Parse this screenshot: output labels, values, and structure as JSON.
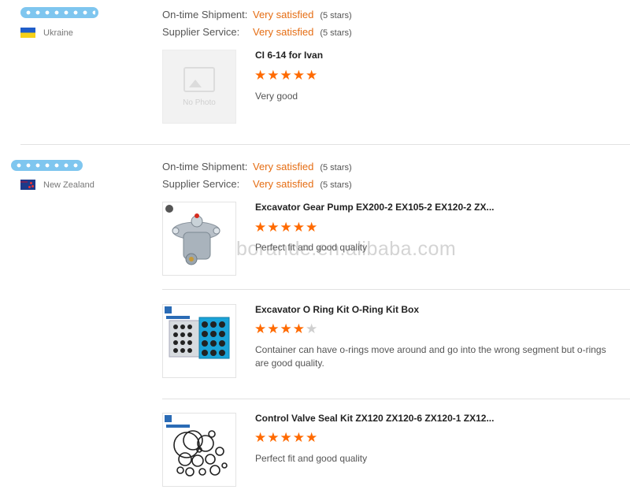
{
  "reviews": [
    {
      "country": "Ukraine",
      "shipment_label": "On-time Shipment:",
      "shipment_value": "Very satisfied",
      "shipment_stars": "(5 stars)",
      "service_label": "Supplier Service:",
      "service_value": "Very satisfied",
      "service_stars": "(5 stars)",
      "items": [
        {
          "image_text": "No Photo",
          "title": "CI 6-14 for Ivan",
          "rating": 5,
          "comment": "Very good"
        }
      ]
    },
    {
      "country": "New Zealand",
      "shipment_label": "On-time Shipment:",
      "shipment_value": "Very satisfied",
      "shipment_stars": "(5 stars)",
      "service_label": "Supplier Service:",
      "service_value": "Very satisfied",
      "service_stars": "(5 stars)",
      "items": [
        {
          "title": "Excavator Gear Pump EX200-2 EX105-2 EX120-2 ZX...",
          "rating": 5,
          "comment": "Perfect fit and good quality"
        },
        {
          "title": "Excavator O Ring Kit O-Ring Kit Box",
          "rating": 4,
          "comment": "Container can have o-rings move around and go into the wrong segment but o-rings are good quality."
        },
        {
          "title": "Control Valve Seal Kit ZX120 ZX120-6 ZX120-1 ZX12...",
          "rating": 5,
          "comment": "Perfect fit and good quality"
        }
      ]
    }
  ],
  "watermark": "borande.en.alibaba.com",
  "colors": {
    "accent": "#e56d13",
    "star": "#ff6a00",
    "star_off": "#cfcfcf",
    "blob": "#7fc6ef"
  }
}
